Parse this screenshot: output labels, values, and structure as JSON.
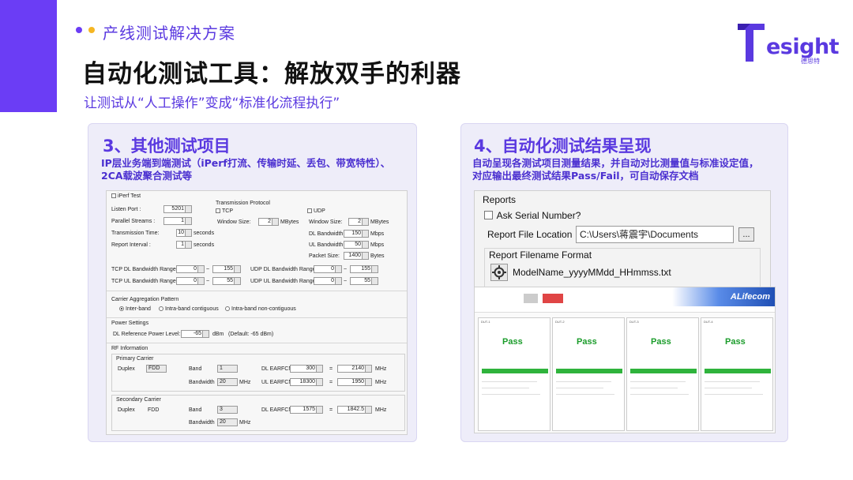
{
  "header": {
    "kicker": "产线测试解决方案",
    "title": "自动化测试工具：解放双手的利器",
    "subtitle": "让测试从“人工操作”变成“标准化流程执行”",
    "logo_text": "esight",
    "logo_cn": "德思特"
  },
  "colors": {
    "accent": "#6b3df5",
    "dot_yellow": "#f5b623",
    "panel_bg": "#eeedf9",
    "pass_green": "#1a9c2a"
  },
  "left_panel": {
    "title": "3、其他测试项目",
    "desc_line1": "IP层业务端到端测试（iPerf打流、传输时延、丢包、带宽特性）、",
    "desc_line2": "2CA载波聚合测试等",
    "iperf": {
      "iperf_test": "iPerf Test",
      "listen_port_label": "Listen Port :",
      "listen_port": "5201",
      "parallel_label": "Parallel Streams :",
      "parallel": "1",
      "trans_time_label": "Transmission Time:",
      "trans_time": "10",
      "seconds": "seconds",
      "report_interval_label": "Report Interval :",
      "report_interval": "1",
      "protocol_label": "Transmission Protocol",
      "tcp": "TCP",
      "udp": "UDP",
      "window_size_label": "Window Size:",
      "tcp_window": "2",
      "mbytes": "MBytes",
      "udp_window": "2",
      "dl_bw_label": "DL Bandwidth",
      "dl_bw": "150",
      "mbps": "Mbps",
      "ul_bw_label": "UL Bandwidth",
      "ul_bw": "50",
      "packet_size_label": "Packet Size:",
      "packet_size": "1400",
      "bytes": "Bytes",
      "tcp_dl_range_label": "TCP DL Bandwidth Range:",
      "tcp_dl_min": "0",
      "tcp_dl_max": "155",
      "tcp_ul_range_label": "TCP UL Bandwidth Range",
      "tcp_ul_min": "0",
      "tcp_ul_max": "55",
      "udp_dl_range_label": "UDP DL Bandwidth Range",
      "udp_dl_min": "0",
      "udp_dl_max": "155",
      "udp_ul_range_label": "UDP UL Bandwidth Range",
      "udp_ul_min": "0",
      "udp_ul_max": "55",
      "tilde": "~"
    },
    "ca": {
      "pattern_label": "Carrier Aggregation Pattern",
      "inter_band": "Inter-band",
      "intra_contig": "Intra-band contiguous",
      "intra_noncontig": "Intra-band non-contiguous"
    },
    "power": {
      "label": "Power Settings",
      "dl_ref_label": "DL Reference Power Level:",
      "dl_ref": "-65",
      "dbm": "dBm",
      "default": "(Default: -65 dBm)"
    },
    "rf": {
      "label": "RF Information",
      "primary": "Primary Carrier",
      "secondary": "Secondary Carrier",
      "duplex_label": "Duplex",
      "p_duplex": "FDD",
      "s_duplex": "FDD",
      "band_label": "Band",
      "p_band": "1",
      "s_band": "3",
      "bandwidth_label": "Bandwidth",
      "p_bw": "20",
      "s_bw": "20",
      "mhz": "MHz",
      "dl_earfcn_label": "DL EARFCN",
      "ul_earfcn_label": "UL EARFCN",
      "p_dl_earfcn": "300",
      "p_dl_freq": "2140",
      "p_ul_earfcn": "18300",
      "p_ul_freq": "1950",
      "s_dl_earfcn": "1575",
      "s_dl_freq": "1842.5",
      "equals": "="
    }
  },
  "right_panel": {
    "title": "4、自动化测试结果呈现",
    "desc_line1": "自动呈现各测试项目测量结果，并自动对比测量值与标准设定值，",
    "desc_line2": "对应输出最终测试结果Pass/Fail，可自动保存文档",
    "reports": {
      "label": "Reports",
      "ask_serial": "Ask Serial Number?",
      "file_location_label": "Report File Location",
      "file_location": "C:\\Users\\蒋震宇\\Documents",
      "browse": "...",
      "filename_format_label": "Report Filename Format",
      "filename_format": "ModelName_yyyyMMdd_HHmmss.txt"
    },
    "results": {
      "brand": "ALifecom",
      "duts": [
        {
          "name": "DUT-1",
          "result": "Pass"
        },
        {
          "name": "DUT-2",
          "result": "Pass"
        },
        {
          "name": "DUT-3",
          "result": "Pass"
        },
        {
          "name": "DUT-4",
          "result": "Pass"
        }
      ]
    }
  }
}
